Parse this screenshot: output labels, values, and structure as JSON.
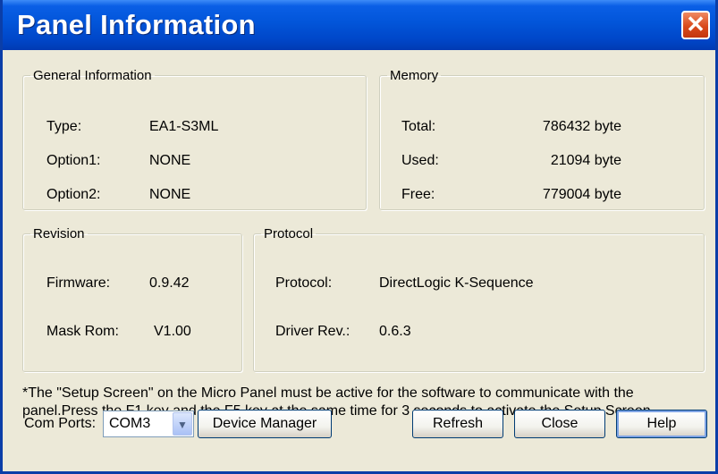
{
  "window": {
    "title": "Panel Information",
    "close_glyph": "✕"
  },
  "general": {
    "legend": "General Information",
    "type_label": "Type:",
    "type_value": "EA1-S3ML",
    "option1_label": "Option1:",
    "option1_value": "NONE",
    "option2_label": "Option2:",
    "option2_value": "NONE"
  },
  "memory": {
    "legend": "Memory",
    "total_label": "Total:",
    "total_value": "786432 byte",
    "used_label": "Used:",
    "used_value": "21094 byte",
    "free_label": "Free:",
    "free_value": "779004 byte"
  },
  "revision": {
    "legend": "Revision",
    "firmware_label": "Firmware:",
    "firmware_value": "0.9.42",
    "maskrom_label": "Mask Rom:",
    "maskrom_value": "V1.00"
  },
  "protocol": {
    "legend": "Protocol",
    "protocol_label": "Protocol:",
    "protocol_value": "DirectLogic K-Sequence",
    "driver_label": "Driver Rev.:",
    "driver_value": "0.6.3"
  },
  "note": {
    "line1": "*The \"Setup Screen\" on the Micro Panel must be active for the software to communicate with the",
    "line2": "panel.Press the F1 key and the F5 key at the same time for 3 seconds to activate the Setup Screen."
  },
  "footer": {
    "com_ports_label": "Com Ports:",
    "com_ports_value": "COM3",
    "device_manager_label": "Device Manager",
    "refresh_label": "Refresh",
    "close_label": "Close",
    "help_label": "Help"
  },
  "colors": {
    "title_bar": "#0255d9",
    "close_button": "#d94a1c",
    "dialog_bg": "#ece9d8"
  },
  "icons": {
    "close": "close-icon",
    "dropdown": "chevron-down-icon"
  }
}
